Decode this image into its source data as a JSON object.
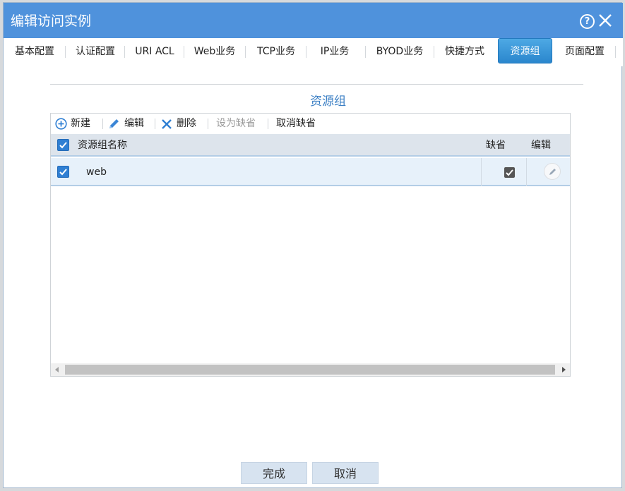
{
  "dialog": {
    "title": "编辑访问实例",
    "help_symbol": "?"
  },
  "tabs": [
    {
      "label": "基本配置"
    },
    {
      "label": "认证配置"
    },
    {
      "label": "URI ACL"
    },
    {
      "label": "Web业务"
    },
    {
      "label": "TCP业务"
    },
    {
      "label": "IP业务"
    },
    {
      "label": "BYOD业务"
    },
    {
      "label": "快捷方式"
    },
    {
      "label": "资源组",
      "active": true
    },
    {
      "label": "页面配置"
    }
  ],
  "section": {
    "title": "资源组"
  },
  "toolbar": {
    "new_label": "新建",
    "edit_label": "编辑",
    "delete_label": "删除",
    "set_default_label": "设为缺省",
    "cancel_default_label": "取消缺省"
  },
  "table": {
    "columns": {
      "name": "资源组名称",
      "default": "缺省",
      "edit": "编辑"
    },
    "rows": [
      {
        "name": "web",
        "selected": true,
        "is_default": true
      }
    ]
  },
  "footer": {
    "done_label": "完成",
    "cancel_label": "取消"
  },
  "colors": {
    "titlebar": "#4f92dc",
    "accent": "#2f7fd3",
    "section_title": "#3b7fc4"
  }
}
